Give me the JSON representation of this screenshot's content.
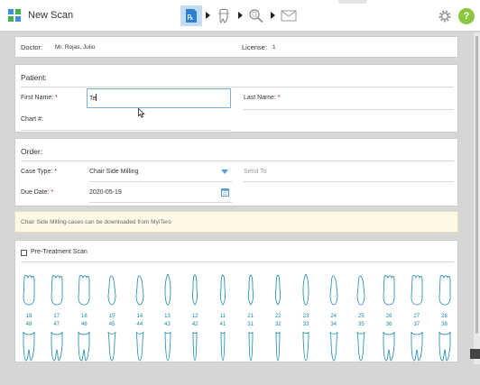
{
  "header": {
    "title": "New Scan",
    "logo_colors": [
      "#3f8fe0",
      "#45b04a",
      "#45b04a",
      "#3f8fe0"
    ],
    "workflow": [
      {
        "name": "rx-step",
        "icon": "rx-icon",
        "active": true
      },
      {
        "name": "scan-step",
        "icon": "tooth-scan-icon",
        "active": false
      },
      {
        "name": "view-step",
        "icon": "magnifier-tooth-icon",
        "active": false
      },
      {
        "name": "send-step",
        "icon": "envelope-icon",
        "active": false
      }
    ],
    "rx_symbol": "℞",
    "help_symbol": "?",
    "accent": "#2d7fd0",
    "help_color": "#8dc63f"
  },
  "doctor": {
    "label": "Doctor:",
    "value": "Mr. Rojas, Julio",
    "license_label": "License:",
    "license_value": "1"
  },
  "patient": {
    "title": "Patient:",
    "first_name_label": "First Name:",
    "first_name_value": "Te",
    "last_name_label": "Last Name:",
    "chart_label": "Chart #:",
    "required_mark": "*"
  },
  "order": {
    "title": "Order:",
    "case_type_label": "Case Type:",
    "case_type_value": "Chair Side Milling",
    "send_to_label": "Send To",
    "due_date_label": "Due Date:",
    "due_date_value": "2020-05-19",
    "required_mark": "*"
  },
  "banner": {
    "text": "Chair Side Milling cases can be downloaded from MyiTero"
  },
  "teeth": {
    "pretreatment_label": "Pre-Treatment Scan",
    "upper": [
      "18",
      "17",
      "16",
      "15",
      "14",
      "13",
      "12",
      "11",
      "21",
      "22",
      "23",
      "24",
      "25",
      "26",
      "27",
      "28"
    ],
    "lower": [
      "48",
      "47",
      "46",
      "45",
      "44",
      "43",
      "42",
      "41",
      "31",
      "32",
      "33",
      "34",
      "35",
      "36",
      "37",
      "38"
    ],
    "tooth_color": "#1a87a8"
  }
}
